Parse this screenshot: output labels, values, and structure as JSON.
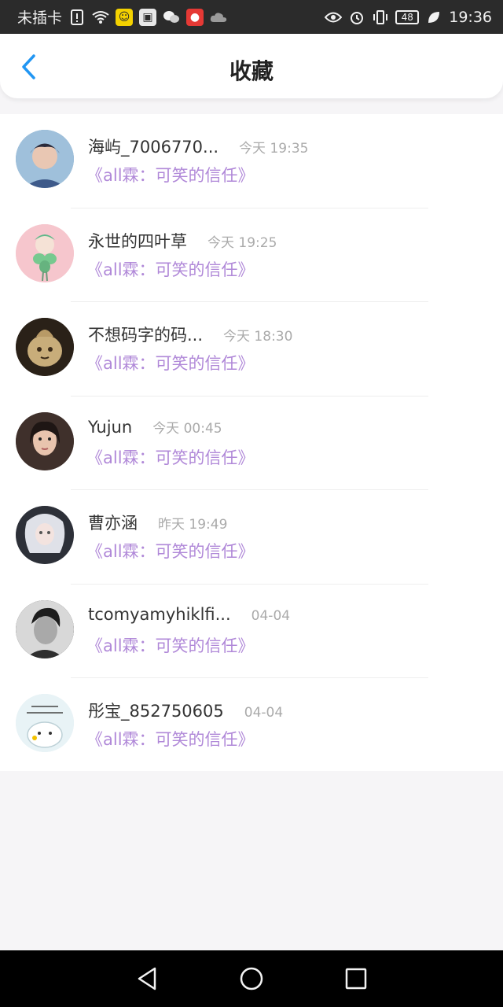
{
  "status_bar": {
    "carrier": "未插卡",
    "battery": "48",
    "time": "19:36",
    "left_icons": [
      "sim-alert-icon",
      "wifi-icon",
      "app-yellow-icon",
      "app-huawei-icon",
      "wechat-icon",
      "app-red-icon",
      "cloud-icon"
    ],
    "right_icons": [
      "eye-icon",
      "alarm-icon",
      "vibrate-icon",
      "battery-icon",
      "leaf-icon"
    ]
  },
  "header": {
    "title": "收藏"
  },
  "list": {
    "items": [
      {
        "name": "海屿_7006770...",
        "time": "今天 19:35",
        "work": "《all霖：可笑的信任》",
        "avatar_color": "#7fa7c9"
      },
      {
        "name": "永世的四叶草",
        "time": "今天 19:25",
        "work": "《all霖：可笑的信任》",
        "avatar_color": "#f6c6cd"
      },
      {
        "name": "不想码字的码...",
        "time": "今天 18:30",
        "work": "《all霖：可笑的信任》",
        "avatar_color": "#b59a6a"
      },
      {
        "name": "Yujun",
        "time": "今天 00:45",
        "work": "《all霖：可笑的信任》",
        "avatar_color": "#5a4a44"
      },
      {
        "name": "曹亦涵",
        "time": "昨天 19:49",
        "work": "《all霖：可笑的信任》",
        "avatar_color": "#6b6f7a"
      },
      {
        "name": "tcomyamyhiklfi...",
        "time": "04-04",
        "work": "《all霖：可笑的信任》",
        "avatar_color": "#4a4a4a"
      },
      {
        "name": "彤宝_852750605",
        "time": "04-04",
        "work": "《all霖：可笑的信任》",
        "avatar_color": "#dfeef2"
      }
    ]
  },
  "colors": {
    "accent": "#2196f3",
    "work_title": "#b088d8",
    "time": "#aaaaaa"
  }
}
